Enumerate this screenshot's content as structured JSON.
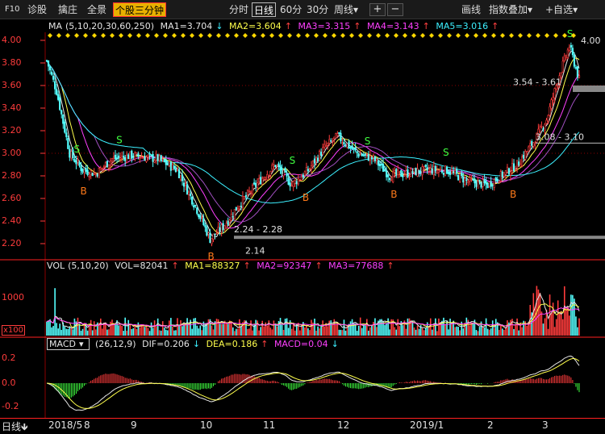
{
  "toolbar": {
    "f10": "F10",
    "diagnose": "诊股",
    "pick_top": "擒庄",
    "panorama": "全景",
    "stock_tab": "个股三分钟",
    "intervals": [
      "分时",
      "日线",
      "60分",
      "30分"
    ],
    "week": "周线",
    "week_arrow": "▾",
    "zoom_in": "+",
    "zoom_out": "−",
    "draw_line": "画线",
    "index_overlay": "指数叠加",
    "add_watch": "+自选",
    "dropdown": "▾"
  },
  "ma_row": {
    "name": "MA",
    "params": "(5,10,20,30,60,250)",
    "ma1": "MA1=3.704",
    "ma2": "MA2=3.604",
    "ma3": "MA3=3.315",
    "ma4": "MA4=3.143",
    "ma5": "MA5=3.016",
    "arrow_down": "↓",
    "arrow_up": "↑"
  },
  "vol_row": {
    "name": "VOL",
    "params": "(5,10,20)",
    "vol": "VOL=82041",
    "ma1": "MA1=88327",
    "ma2": "MA2=92347",
    "ma3": "MA3=77688",
    "arrow_up": "↑"
  },
  "macd_row": {
    "name": "MACD",
    "params": "(26,12,9)",
    "dif": "DIF=0.206",
    "dea": "DEA=0.186",
    "macd": "MACD=0.04",
    "arrow_down": "↓",
    "arrow_up": "↑"
  },
  "price_axis": [
    "4.00",
    "3.80",
    "3.60",
    "3.40",
    "3.20",
    "3.00",
    "2.80",
    "2.60",
    "2.40",
    "2.20"
  ],
  "vol_axis": [
    "1000",
    "x100"
  ],
  "macd_axis": [
    "0.2",
    "0.0",
    "-0.2"
  ],
  "annotations": {
    "high": "4.00",
    "low": "2.14",
    "range_low": "2.24 - 2.28",
    "range_mid": "3.08 - 3.10",
    "range_high": "3.54 - 3.61",
    "buy": "B",
    "sell": "S"
  },
  "bottom": {
    "period": "日线",
    "period_arrow": "🡻",
    "dates": [
      "2018/5",
      "8",
      "9",
      "10",
      "11",
      "12",
      "2019/1",
      "2",
      "3"
    ]
  },
  "colors": {
    "up": "#ff3c3c",
    "down": "#54ffff",
    "ma1": "#e6e6e6",
    "ma2": "#ffff4c",
    "ma3": "#ff40ff",
    "ma4": "#3cf0ff",
    "ma5": "#ff4040",
    "grid": "#8b0000"
  }
}
